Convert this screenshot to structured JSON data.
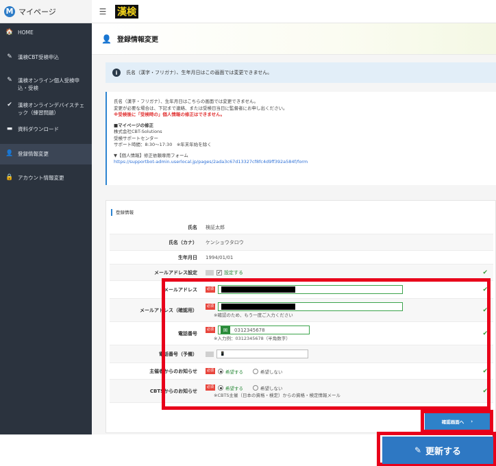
{
  "brand": {
    "logo_letter": "M",
    "label": "マイページ"
  },
  "header": {
    "menu_icon": "☰",
    "logo_text": "漢検"
  },
  "sidebar": {
    "items": [
      {
        "icon": "home-icon",
        "glyph": "🏠",
        "label": "HOME"
      },
      {
        "icon": "pencil-icon",
        "glyph": "✎",
        "label": "漢検CBT受検申込"
      },
      {
        "icon": "pencil-icon",
        "glyph": "✎",
        "label": "漢検オンライン個人受検申込・受検"
      },
      {
        "icon": "check-icon",
        "glyph": "✔",
        "label": "漢検オンラインデバイスチェック（練習問題）"
      },
      {
        "icon": "folder-icon",
        "glyph": "▬",
        "label": "資料ダウンロード"
      },
      {
        "icon": "user-icon",
        "glyph": "👤",
        "label": "登録情報変更"
      },
      {
        "icon": "lock-icon",
        "glyph": "🔒",
        "label": "アカウント情報変更"
      }
    ]
  },
  "page": {
    "title": "登録情報変更",
    "title_icon": "👤"
  },
  "alert": {
    "icon": "i",
    "text": "氏名（漢字・フリガナ）、生年月日はこの画面では変更できません。"
  },
  "notice": {
    "line1": "氏名（漢字・フリガナ）、生年月日はこちらの画面では変更できません。",
    "line2": "変更が必要な場合は、下記まで連絡、または受検日当日に監督者にお申し出ください。",
    "line3": "※受検後に「受検時の」個人情報の修正はできません。",
    "heading": "■マイページの修正",
    "company": "株式会社CBT-Solutions",
    "support": "受検サポートセンター",
    "hours": "サポート時間：8:30〜17:30　※年末年始を除く",
    "form_label": "▼【個人情報】修正依頼専用フォーム",
    "form_url": "https://supportbot-admin.userlocal.jp/pages/2ada3c67d13327cf8fc4d9ff392a584f/form"
  },
  "form": {
    "section_title": "登録情報",
    "name_label": "氏名",
    "name_value": "検証太郎",
    "kana_label": "氏名（カナ）",
    "kana_value": "ケンショウタロウ",
    "birth_label": "生年月日",
    "birth_value": "1994/01/01",
    "mail_setting_label": "メールアドレス設定",
    "mail_setting_value": "設定する",
    "mail_label": "メールアドレス",
    "mail_confirm_label": "メールアドレス（確認用）",
    "mail_confirm_hint": "※確認のため、もう一度ご入力ください",
    "tel_label": "電話番号",
    "tel_chip": "固",
    "tel_value": "0312345678",
    "tel_hint": "※入力例：0312345678（半角数字）",
    "tel2_label": "電話番号（予備）",
    "tel2_icon": "📱",
    "host_label": "主催者からのお知らせ",
    "cbt_label": "CBTSからのお知らせ",
    "cbt_hint": "※CBTS主催（日本の資格・検定）からの資格・検定情報メール",
    "radio_yes": "希望する",
    "radio_no": "希望しない",
    "required_badge": "必須",
    "check_mark": "✔"
  },
  "buttons": {
    "confirm": "確認画面へ",
    "confirm_arrow": "›",
    "update": "更新する",
    "update_icon": "✎"
  },
  "colors": {
    "sidebar_bg": "#2b333e",
    "accent_blue": "#2e82c9",
    "highlight_red": "#e8001a",
    "required_red": "#e8453c",
    "valid_green": "#3aa34a"
  }
}
